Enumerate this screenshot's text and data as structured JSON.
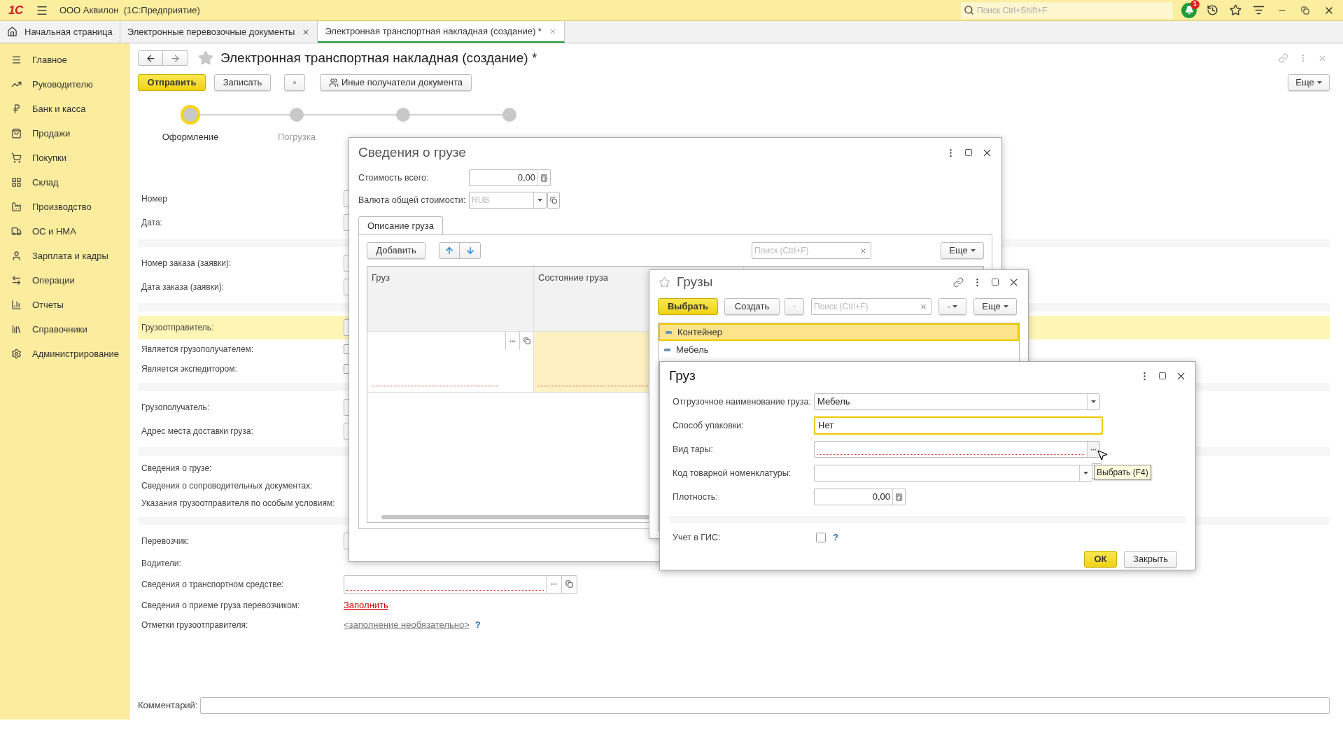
{
  "app": {
    "logo": "1С",
    "title": "ООО Аквилон  (1С:Предприятие)",
    "search": {
      "placeholder": "Поиск Ctrl+Shift+F"
    },
    "notifications": "1"
  },
  "tabs": [
    {
      "label": "Начальная страница",
      "kind": "home",
      "selected": false
    },
    {
      "label": "Электронные перевозочные документы",
      "kind": "closable",
      "selected": false
    },
    {
      "label": "Электронная транспортная накладная (создание) *",
      "kind": "closable",
      "selected": true
    }
  ],
  "sidebar": {
    "items": [
      {
        "label": "Главное",
        "kind": "menu"
      },
      {
        "label": "Руководителю",
        "kind": "trend"
      },
      {
        "label": "Банк и касса",
        "kind": "ruble"
      },
      {
        "label": "Продажи",
        "kind": "bag"
      },
      {
        "label": "Покупки",
        "kind": "cart"
      },
      {
        "label": "Склад",
        "kind": "grid"
      },
      {
        "label": "Производство",
        "kind": "factory"
      },
      {
        "label": "ОС и НМА",
        "kind": "truck"
      },
      {
        "label": "Зарплата и кадры",
        "kind": "person"
      },
      {
        "label": "Операции",
        "kind": "exchange"
      },
      {
        "label": "Отчеты",
        "kind": "chart"
      },
      {
        "label": "Справочники",
        "kind": "books"
      },
      {
        "label": "Администрирование",
        "kind": "gear"
      }
    ]
  },
  "document": {
    "title": "Электронная транспортная накладная (создание) *",
    "favorite": false,
    "send": "Отправить",
    "save": "Записать",
    "recipients": "Иные получатели документа",
    "more": "Еще"
  },
  "steps": [
    {
      "label": "Оформление",
      "selected": true
    },
    {
      "label": "Погрузка",
      "selected": false
    },
    {
      "selected": false
    },
    {
      "selected": false
    }
  ],
  "form": {
    "groups": [
      {
        "rows": [
          {
            "label": "Номер",
            "kind": "input",
            "highlighted": false
          },
          {
            "label": "Дата:",
            "kind": "input",
            "highlighted": false
          }
        ]
      },
      {
        "rows": [
          {
            "label": "Номер заказа (заявки):",
            "kind": "input",
            "highlighted": false
          },
          {
            "label": "Дата заказа (заявки):",
            "kind": "input",
            "highlighted": false
          }
        ]
      },
      {
        "rows": [
          {
            "label": "Грузоотправитель:",
            "kind": "input",
            "highlighted": true
          },
          {
            "label": "Является грузополучателем:",
            "kind": "check",
            "highlighted": false
          },
          {
            "label": "Является экспедитором:",
            "kind": "check",
            "highlighted": false
          }
        ]
      },
      {
        "rows": [
          {
            "label": "Грузополучатель:",
            "kind": "input",
            "highlighted": false
          },
          {
            "label": "Адрес места доставки груза:",
            "kind": "input",
            "highlighted": false
          }
        ]
      },
      {
        "rows": [
          {
            "label": "Сведения о грузе:",
            "kind": "label",
            "highlighted": false
          },
          {
            "label": "Сведения о сопроводительных документах:",
            "kind": "label",
            "highlighted": false
          },
          {
            "label": "Указания грузоотправителя по особым условиям:",
            "kind": "label",
            "highlighted": false
          }
        ]
      },
      {
        "rows": [
          {
            "label": "Перевозчик:",
            "kind": "input",
            "highlighted": false
          },
          {
            "label": "Водители:",
            "kind": "link",
            "highlighted": false
          },
          {
            "label": "Сведения о транспортном средстве:",
            "kind": "field",
            "highlighted": false
          },
          {
            "label": "Сведения о приеме груза перевозчиком:",
            "kind": "link",
            "value": "Заполнить",
            "highlighted": false
          },
          {
            "label": "Отметки грузоотправителя:",
            "kind": "optional",
            "value": "<заполнение необязательно>",
            "help": "?",
            "highlighted": false
          }
        ]
      }
    ]
  },
  "comment": {
    "label": "Комментарий:"
  },
  "cargo_info_dialog": {
    "title": "Сведения о грузе",
    "total": {
      "label": "Стоимость всего:",
      "value": "0,00"
    },
    "currency": {
      "label": "Валюта общей стоимости:",
      "placeholder": "RUB"
    },
    "tabs": [
      {
        "label": "Описание груза",
        "selected": true
      }
    ],
    "add": "Добавить",
    "search": {
      "placeholder": "Поиск (Ctrl+F)"
    },
    "more": "Еще",
    "table": {
      "columns": [
        "Груз",
        "Состояние груза"
      ],
      "rows": [
        {
          "cells": [
            {
              "selected": false,
              "required": true
            },
            {
              "selected": true,
              "required": true
            }
          ]
        }
      ]
    }
  },
  "cargo_list_dialog": {
    "title": "Грузы",
    "favorite": false,
    "choose": "Выбрать",
    "create": "Создать",
    "search": {
      "placeholder": "Поиск (Ctrl+F)"
    },
    "more": "Еще",
    "items": [
      {
        "label": "Контейнер",
        "selected": true
      },
      {
        "label": "Мебель",
        "selected": false
      }
    ]
  },
  "cargo_dialog": {
    "title": "Груз",
    "fields": [
      {
        "label": "Отгрузочное наименование груза:",
        "kind": "dropdown",
        "value": "Мебель",
        "focused": false,
        "required": false
      },
      {
        "label": "Способ упаковки:",
        "kind": "text",
        "value": "Нет",
        "focused": true,
        "required": false
      },
      {
        "label": "Вид тары:",
        "kind": "choice",
        "focused": false,
        "required": true
      },
      {
        "label": "Код товарной номенклатуры:",
        "kind": "dropdown_open",
        "focused": false,
        "required": false
      },
      {
        "label": "Плотность:",
        "kind": "number",
        "value": "0,00",
        "focused": false,
        "required": false
      }
    ],
    "gis": {
      "label": "Учет в ГИС:",
      "checked": false,
      "help": "?"
    },
    "ok": "ОК",
    "close": "Закрыть",
    "tooltip": "Выбрать (F4)"
  }
}
